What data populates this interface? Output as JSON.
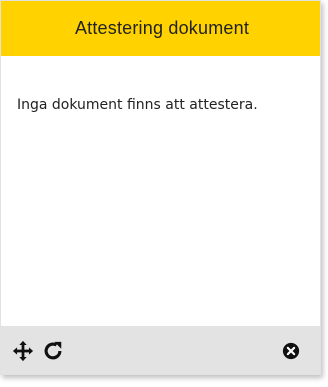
{
  "widget": {
    "title": "Attestering dokument",
    "message": "Inga dokument finns att attestera."
  },
  "toolbar": {
    "move_icon": "move-icon",
    "refresh_icon": "refresh-icon",
    "close_icon": "close-icon"
  },
  "colors": {
    "header_bg": "#ffd200",
    "footer_bg": "#e3e3e3",
    "text": "#222222",
    "icon": "#111111"
  }
}
